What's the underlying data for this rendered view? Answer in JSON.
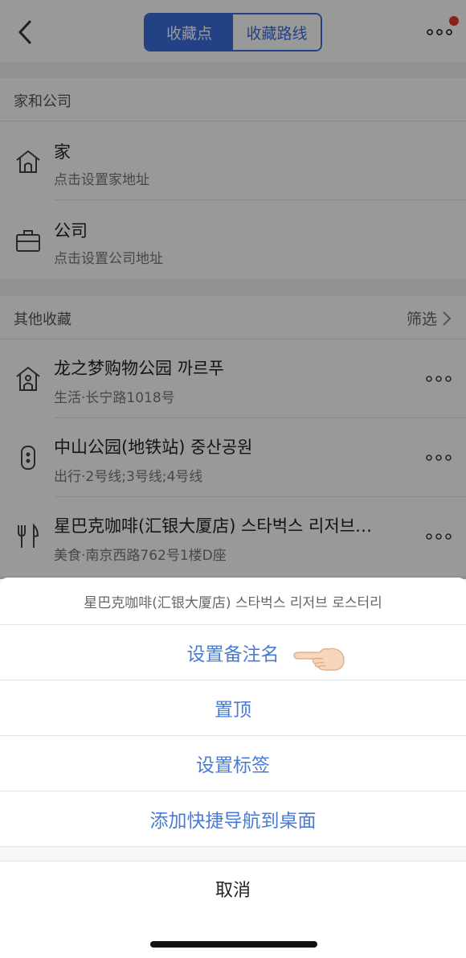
{
  "header": {
    "tabs": [
      {
        "label": "收藏点",
        "active": true
      },
      {
        "label": "收藏路线",
        "active": false
      }
    ],
    "accent_color": "#3b6fe0",
    "badge_color": "#e53935"
  },
  "home_company": {
    "section_title": "家和公司",
    "items": [
      {
        "title": "家",
        "subtitle": "点击设置家地址",
        "icon": "house-outline-icon"
      },
      {
        "title": "公司",
        "subtitle": "点击设置公司地址",
        "icon": "briefcase-icon"
      }
    ]
  },
  "others": {
    "section_title": "其他收藏",
    "filter_label": "筛选",
    "items": [
      {
        "title": "龙之梦购物公园 까르푸",
        "subtitle": "生活·长宁路1018号",
        "icon": "store-icon"
      },
      {
        "title": "中山公园(地铁站) 중산공원",
        "subtitle": "出行·2号线;3号线;4号线",
        "icon": "metro-icon"
      },
      {
        "title": "星巴克咖啡(汇银大厦店) 스타벅스 리저브…",
        "subtitle": "美食·南京西路762号1楼D座",
        "icon": "fork-knife-icon"
      }
    ]
  },
  "action_sheet": {
    "title": "星巴克咖啡(汇银大厦店) 스타벅스 리저브 로스터리",
    "options": [
      "设置备注名",
      "置顶",
      "设置标签",
      "添加快捷导航到桌面"
    ],
    "cancel_label": "取消",
    "option_color": "#4a7bd4"
  }
}
